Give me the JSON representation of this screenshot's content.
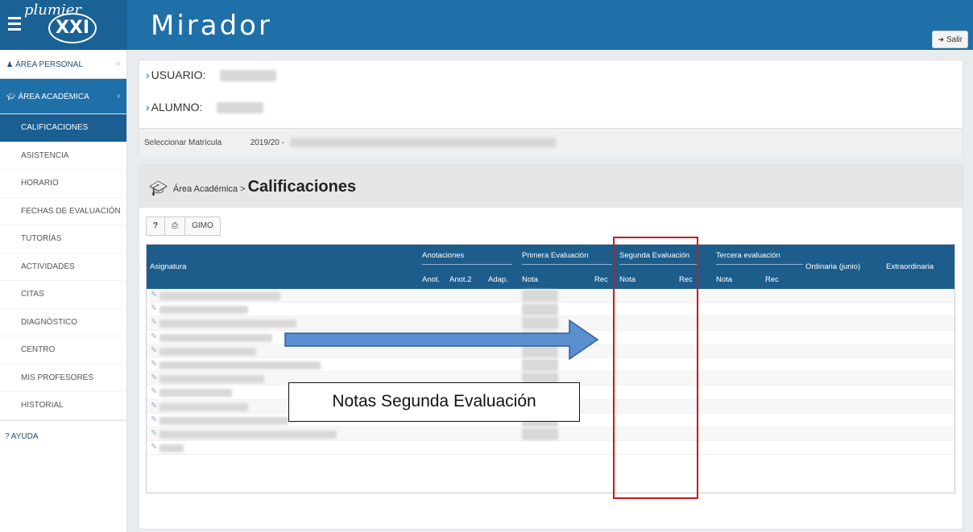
{
  "header": {
    "logo_text": "plumier",
    "logo_mark": "XXI",
    "title": "Mirador",
    "salir_label": "Salir"
  },
  "sidebar": {
    "area_personal": "ÁREA PERSONAL",
    "area_academica": "ÁREA ACADÉMICA",
    "items": [
      {
        "label": "CALIFICACIONES"
      },
      {
        "label": "ASISTENCIA"
      },
      {
        "label": "HORARIO"
      },
      {
        "label": "FECHAS DE EVALUACIÓN"
      },
      {
        "label": "TUTORÍAS"
      },
      {
        "label": "ACTIVIDADES"
      },
      {
        "label": "CITAS"
      },
      {
        "label": "DIAGNÓSTICO"
      },
      {
        "label": "CENTRO"
      },
      {
        "label": "MIS PROFESORES"
      },
      {
        "label": "HISTORIAL"
      }
    ],
    "ayuda": "AYUDA"
  },
  "user_panel": {
    "usuario_label": "USUARIO:",
    "alumno_label": "ALUMNO:",
    "matricula_label": "Seleccionar Matrícula",
    "matricula_value": "2019/20 -"
  },
  "breadcrumb": {
    "parent": "Área Académica",
    "separator": ">",
    "current": "Calificaciones"
  },
  "toolbar": {
    "help": "?",
    "gimo": "GIMO"
  },
  "table": {
    "asignatura": "Asignatura",
    "anotaciones": "Anotaciones",
    "anot": "Anot.",
    "anot2": "Anot.2",
    "adap": "Adap.",
    "primera": "Primera Evaluación",
    "segunda": "Segunda Evaluación",
    "tercera": "Tercera evaluación",
    "nota": "Nota",
    "rec": "Rec",
    "ordinaria": "Ordinaria (junio)",
    "extraordinaria": "Extraordinaria"
  },
  "annotation": {
    "callout_text": "Notas Segunda Evaluación"
  },
  "colors": {
    "header_blue": "#1f6fa8",
    "table_header": "#1d5d8c",
    "highlight_red": "#c61a21",
    "arrow_fill": "#5b8fd0"
  }
}
